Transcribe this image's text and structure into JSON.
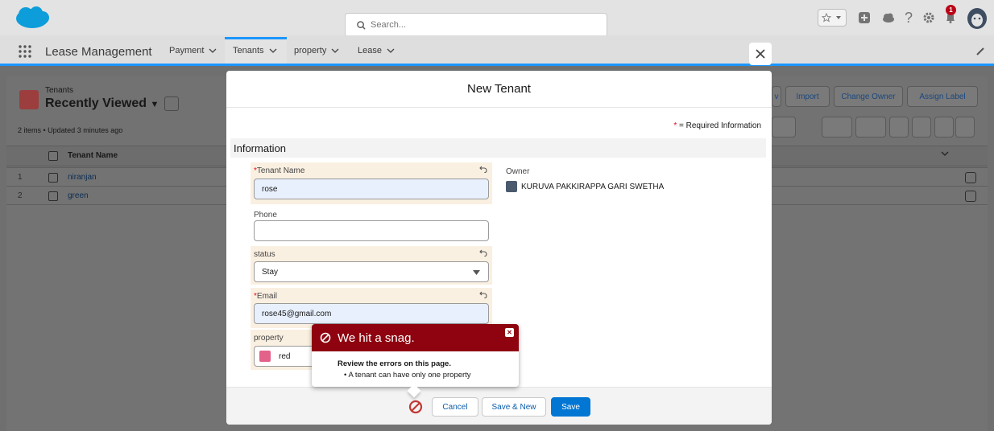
{
  "header": {
    "search_placeholder": "Search...",
    "notification_count": "1"
  },
  "nav": {
    "app_name": "Lease Management",
    "tabs": [
      {
        "label": "Payment"
      },
      {
        "label": "Tenants"
      },
      {
        "label": "property"
      },
      {
        "label": "Lease"
      }
    ]
  },
  "list": {
    "object_label": "Tenants",
    "view_name": "Recently Viewed",
    "meta": "2 items • Updated 3 minutes ago",
    "column": "Tenant Name",
    "rows": [
      {
        "num": "1",
        "name": "niranjan"
      },
      {
        "num": "2",
        "name": "green"
      }
    ],
    "buttons": {
      "partial": "v",
      "import": "Import",
      "change_owner": "Change Owner",
      "assign_label": "Assign Label"
    }
  },
  "modal": {
    "title": "New Tenant",
    "required_star": "*",
    "required_text": " = Required Information",
    "section": "Information",
    "fields": {
      "tenant_name": {
        "label": "Tenant Name",
        "value": "rose",
        "required": "*"
      },
      "phone": {
        "label": "Phone",
        "value": ""
      },
      "status": {
        "label": "status",
        "value": "Stay"
      },
      "email": {
        "label": "Email",
        "value": "rose45@gmail.com",
        "required": "*"
      },
      "property": {
        "label": "property",
        "value": "red"
      }
    },
    "owner": {
      "label": "Owner",
      "value": "KURUVA PAKKIRAPPA GARI SWETHA"
    },
    "buttons": {
      "cancel": "Cancel",
      "save_new": "Save & New",
      "save": "Save"
    }
  },
  "error": {
    "title": "We hit a snag.",
    "subtitle": "Review the errors on this page.",
    "items": [
      "A tenant can have only one property"
    ],
    "color": "#8e030f"
  }
}
